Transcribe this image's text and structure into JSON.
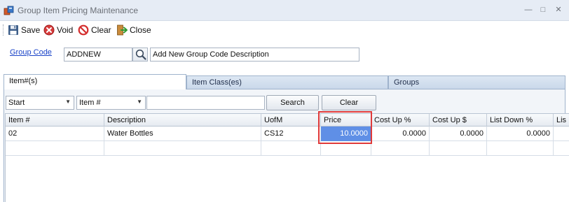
{
  "window": {
    "title": "Group Item Pricing Maintenance",
    "controls": {
      "minimize": "—",
      "maximize": "□",
      "close": "✕"
    }
  },
  "toolbar": {
    "save_label": "Save",
    "void_label": "Void",
    "clear_label": "Clear",
    "close_label": "Close"
  },
  "group_code": {
    "link_label": "Group Code",
    "value": "ADDNEW",
    "description": "Add New Group Code Description"
  },
  "tabs": [
    {
      "label": "Item#(s)",
      "active": true
    },
    {
      "label": "Item Class(es)",
      "active": false
    },
    {
      "label": "Groups",
      "active": false
    }
  ],
  "filter": {
    "match_mode": "Start",
    "field": "Item #",
    "search_label": "Search",
    "clear_label": "Clear"
  },
  "grid": {
    "columns": [
      "Item #",
      "Description",
      "UofM",
      "Price",
      "Cost Up %",
      "Cost Up $",
      "List Down %",
      "Lis"
    ],
    "rows": [
      {
        "item": "02",
        "description": "Water Bottles",
        "uofm": "CS12",
        "price": "10.0000",
        "cost_up_pct": "0.0000",
        "cost_up_amt": "0.0000",
        "list_down_pct": "0.0000",
        "list": ""
      }
    ]
  },
  "colors": {
    "selected_cell": "#5f8fe6",
    "highlight_border": "#e03a3a",
    "link": "#1b44c8"
  }
}
